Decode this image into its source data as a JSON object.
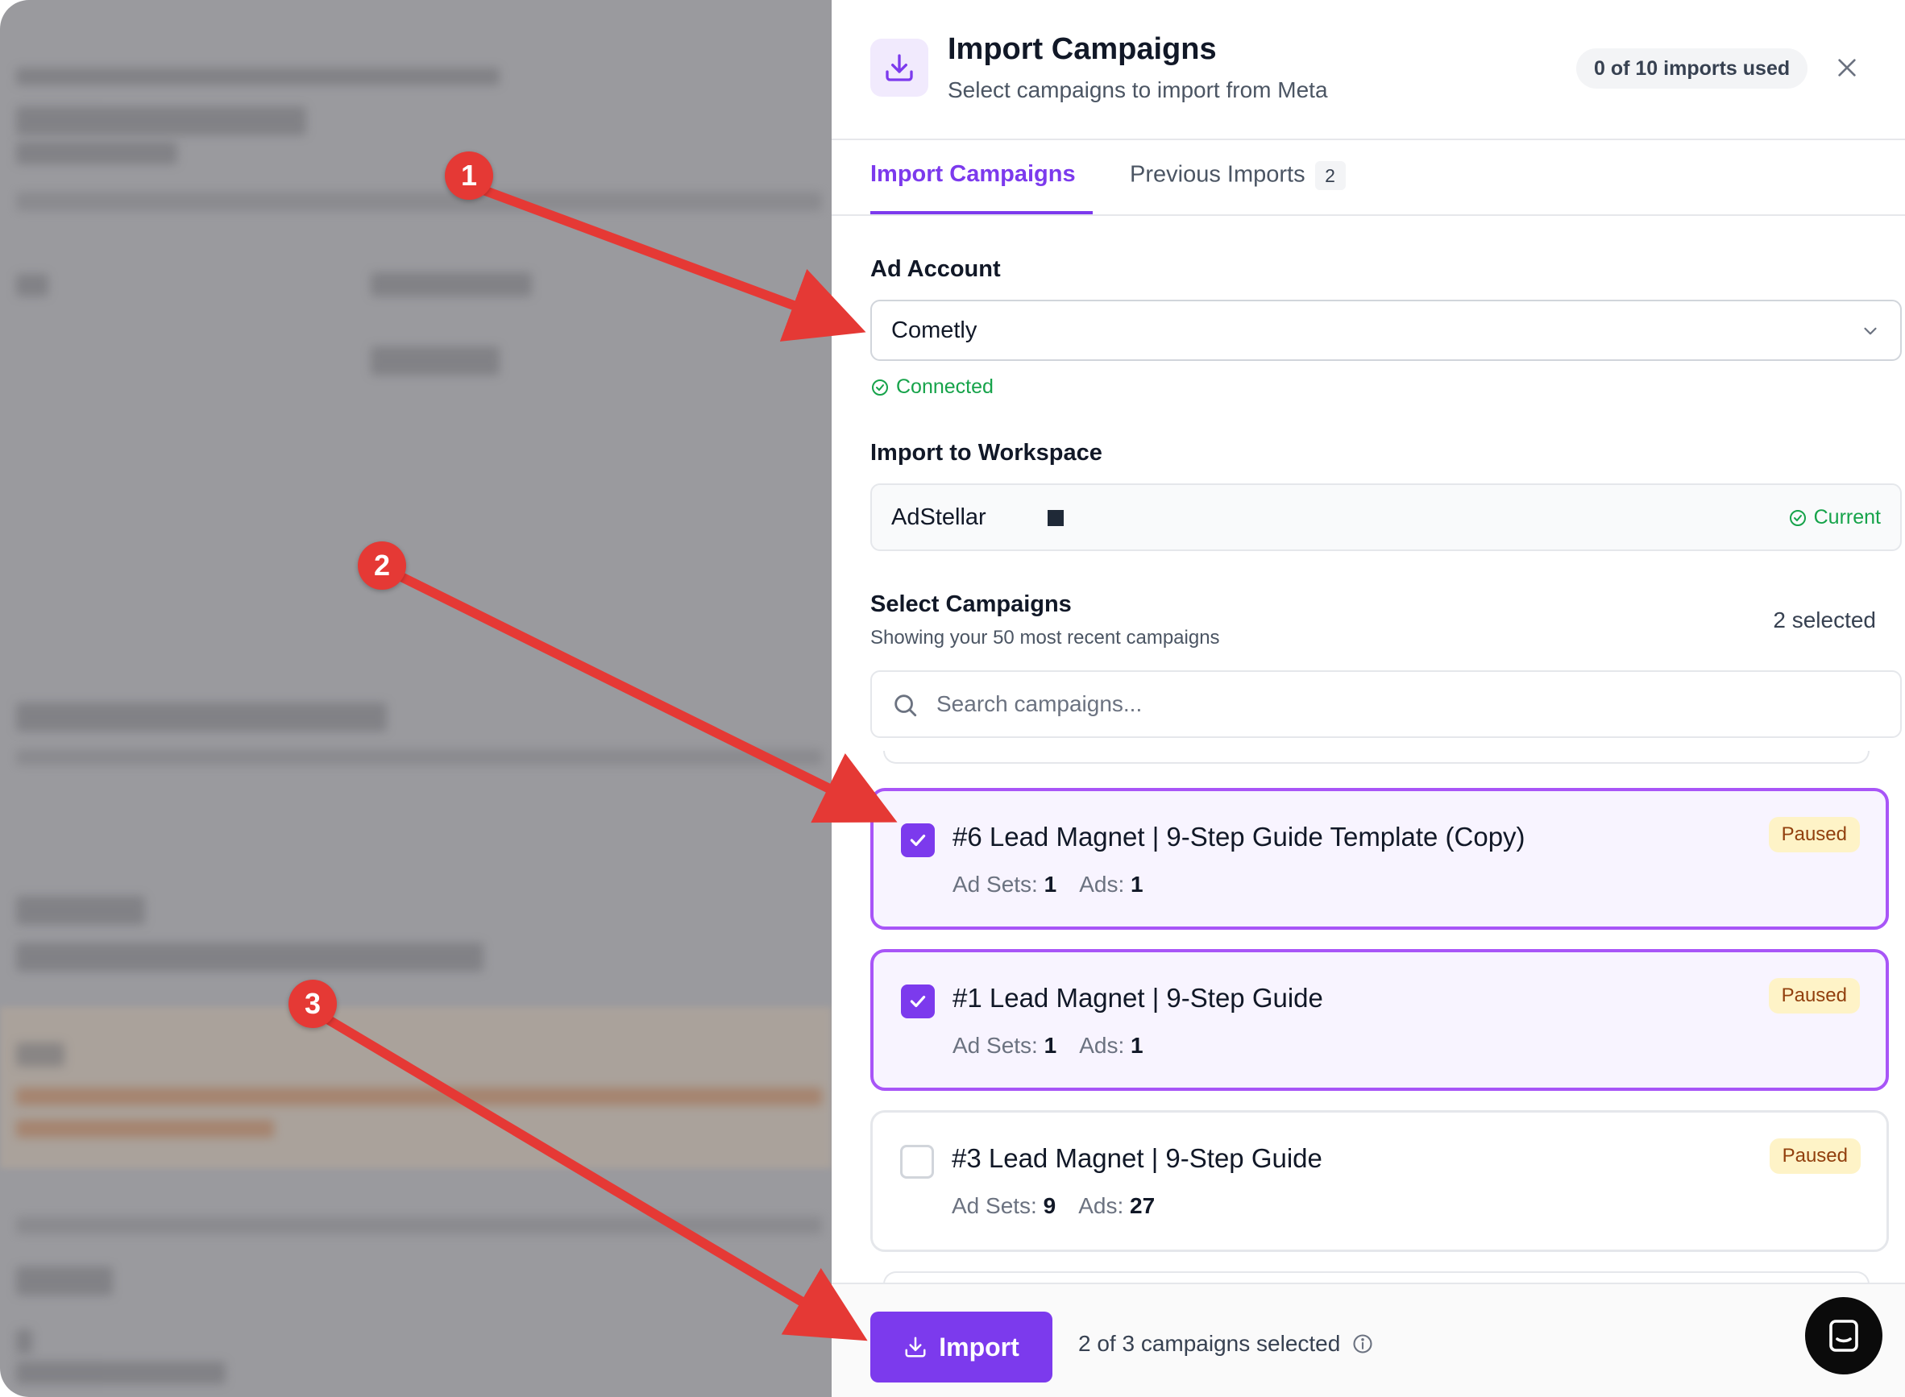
{
  "header": {
    "title": "Import Campaigns",
    "subtitle": "Select campaigns to import from Meta",
    "usage_badge": "0 of 10 imports used",
    "icon": "download-icon",
    "accent_color": "#7c3aed"
  },
  "tabs": [
    {
      "label": "Import Campaigns",
      "active": true
    },
    {
      "label": "Previous Imports",
      "count": "2",
      "active": false
    }
  ],
  "ad_account": {
    "label": "Ad Account",
    "selected": "Cometly",
    "status": "Connected"
  },
  "workspace": {
    "label": "Import to Workspace",
    "name": "AdStellar",
    "status": "Current"
  },
  "campaigns_section": {
    "label": "Select Campaigns",
    "sublabel": "Showing your 50 most recent campaigns",
    "selected_count": "2 selected",
    "search_placeholder": "Search campaigns..."
  },
  "campaigns": [
    {
      "name": "#6 Lead Magnet | 9-Step Guide Template (Copy)",
      "ad_sets_label": "Ad Sets:",
      "ad_sets": "1",
      "ads_label": "Ads:",
      "ads": "1",
      "status": "Paused",
      "checked": true
    },
    {
      "name": "#1 Lead Magnet | 9-Step Guide",
      "ad_sets_label": "Ad Sets:",
      "ad_sets": "1",
      "ads_label": "Ads:",
      "ads": "1",
      "status": "Paused",
      "checked": true
    },
    {
      "name": "#3 Lead Magnet | 9-Step Guide",
      "ad_sets_label": "Ad Sets:",
      "ad_sets": "9",
      "ads_label": "Ads:",
      "ads": "27",
      "status": "Paused",
      "checked": false
    }
  ],
  "footer": {
    "import_label": "Import",
    "summary": "2 of 3 campaigns selected"
  },
  "annotations": [
    "1",
    "2",
    "3"
  ]
}
